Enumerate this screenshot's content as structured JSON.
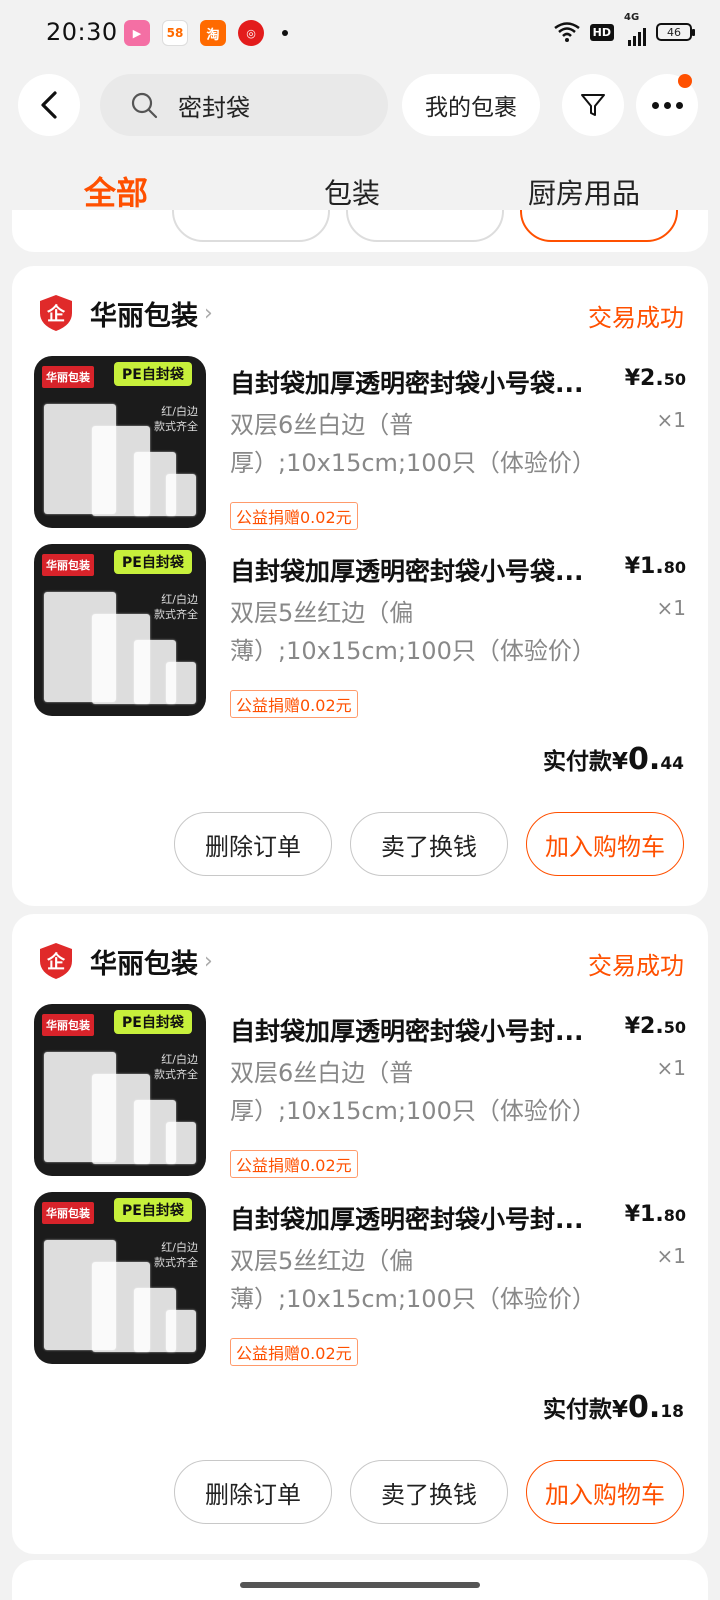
{
  "status_bar": {
    "time": "20:30",
    "apps": [
      "bilibili-icon",
      "58-icon",
      "taobao-icon",
      "netease-music-icon"
    ],
    "hd": "HD",
    "network": "4G",
    "battery": "46"
  },
  "header": {
    "search_text": "密封袋",
    "my_packages": "我的包裹"
  },
  "tabs": [
    {
      "label": "全部",
      "active": true
    },
    {
      "label": "包装",
      "active": false
    },
    {
      "label": "厨房用品",
      "active": false
    }
  ],
  "orders": [
    {
      "shop_name": "华丽包装",
      "status": "交易成功",
      "items": [
        {
          "title": "自封袋加厚透明密封袋小号袋...",
          "spec": "双层6丝白边（普厚）;10x15cm;100只（体验价）",
          "price_int": "¥2.",
          "price_dec": "50",
          "qty": "×1",
          "donation": "公益捐赠0.02元"
        },
        {
          "title": "自封袋加厚透明密封袋小号袋...",
          "spec": "双层5丝红边（偏薄）;10x15cm;100只（体验价）",
          "price_int": "¥1.",
          "price_dec": "80",
          "qty": "×1",
          "donation": "公益捐赠0.02元"
        }
      ],
      "paid_label": "实付款¥",
      "paid_int": "0.",
      "paid_dec": "44",
      "actions": [
        "删除订单",
        "卖了换钱",
        "加入购物车"
      ]
    },
    {
      "shop_name": "华丽包装",
      "status": "交易成功",
      "items": [
        {
          "title": "自封袋加厚透明密封袋小号封...",
          "spec": "双层6丝白边（普厚）;10x15cm;100只（体验价）",
          "price_int": "¥2.",
          "price_dec": "50",
          "qty": "×1",
          "donation": "公益捐赠0.02元"
        },
        {
          "title": "自封袋加厚透明密封袋小号封...",
          "spec": "双层5丝红边（偏薄）;10x15cm;100只（体验价）",
          "price_int": "¥1.",
          "price_dec": "80",
          "qty": "×1",
          "donation": "公益捐赠0.02元"
        }
      ],
      "paid_label": "实付款¥",
      "paid_int": "0.",
      "paid_dec": "18",
      "actions": [
        "删除订单",
        "卖了换钱",
        "加入购物车"
      ]
    }
  ],
  "product_image": {
    "brand": "华丽包装",
    "badge": "PE自封袋",
    "note_line1": "红/白边",
    "note_line2": "款式齐全"
  },
  "colors": {
    "accent": "#ff5000",
    "background": "#f2f2f2",
    "card": "#ffffff"
  }
}
